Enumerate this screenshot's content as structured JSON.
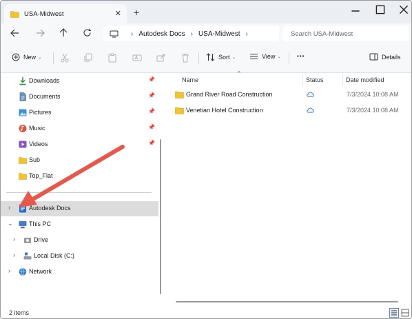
{
  "window": {
    "tab_title": "USA-Midwest",
    "new_tab_label": "+",
    "close_tab_label": "✕"
  },
  "address_bar": {
    "crumbs": [
      "Autodesk Docs",
      "USA-Midwest"
    ],
    "search_placeholder": "Search USA-Midwest"
  },
  "command_bar": {
    "new_label": "New",
    "sort_label": "Sort",
    "view_label": "View",
    "more_label": "•••",
    "details_label": "Details"
  },
  "nav": {
    "quick_access": [
      {
        "label": "Downloads",
        "icon": "download-icon",
        "pinned": true
      },
      {
        "label": "Documents",
        "icon": "document-icon",
        "pinned": true
      },
      {
        "label": "Pictures",
        "icon": "pictures-icon",
        "pinned": true
      },
      {
        "label": "Music",
        "icon": "music-icon",
        "pinned": true
      },
      {
        "label": "Videos",
        "icon": "video-icon",
        "pinned": true
      },
      {
        "label": "Sub",
        "icon": "folder-icon",
        "pinned": false
      },
      {
        "label": "Top_Flat",
        "icon": "folder-icon",
        "pinned": false
      }
    ],
    "tree": [
      {
        "label": "Autodesk Docs",
        "icon": "autodesk-docs-icon",
        "selected": true
      },
      {
        "label": "This PC",
        "icon": "pc-icon",
        "expanded": true
      },
      {
        "label": "Drive",
        "icon": "drive-icon"
      },
      {
        "label": "Local Disk (C:)",
        "icon": "disk-icon"
      },
      {
        "label": "Network",
        "icon": "network-icon"
      }
    ]
  },
  "content": {
    "columns": [
      "Name",
      "Status",
      "Date modified"
    ],
    "rows": [
      {
        "name": "Grand River Road Construction",
        "status": "cloud-icon",
        "date": "7/3/2024 10:08 AM"
      },
      {
        "name": "Venetian Hotel Construction",
        "status": "cloud-icon",
        "date": "7/3/2024 10:08 AM"
      }
    ]
  },
  "status_bar": {
    "item_count": "2 items"
  },
  "colors": {
    "folder": "#f4c430",
    "accent_blue": "#1e6fd0",
    "arrow": "#e8584a",
    "selection": "#dcdcdc"
  }
}
